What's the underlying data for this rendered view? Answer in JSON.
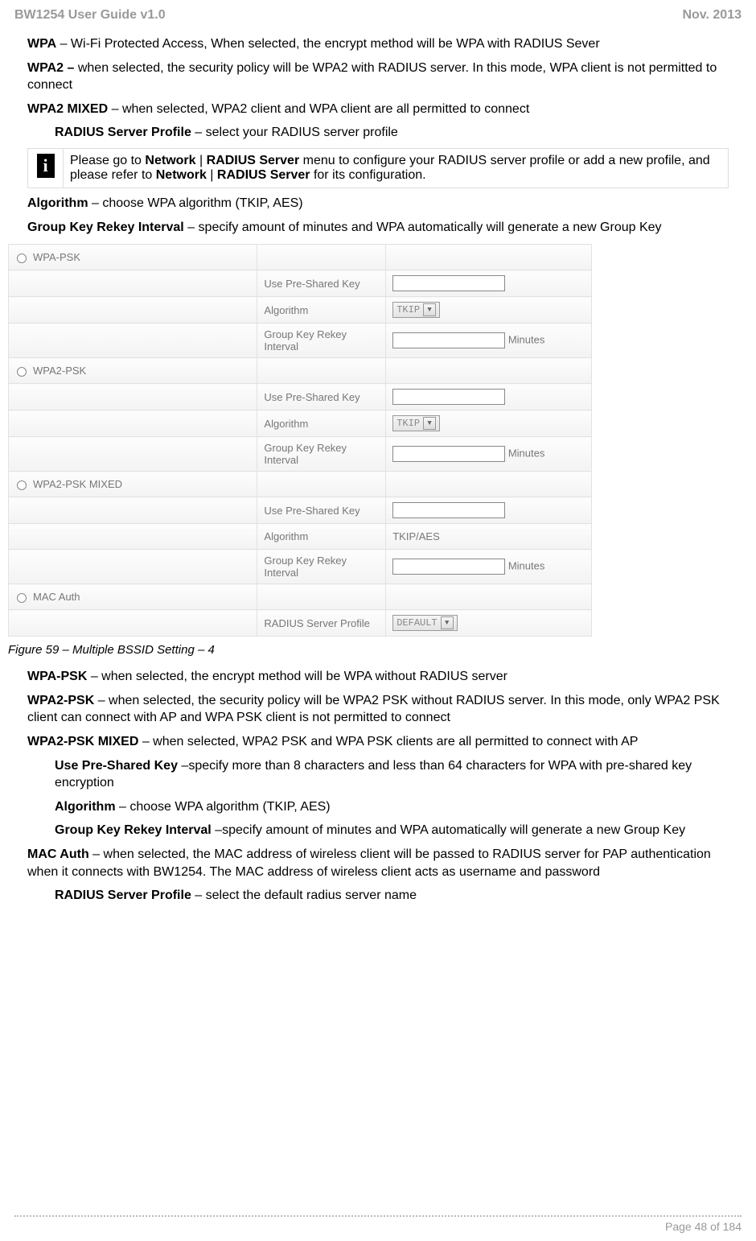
{
  "header": {
    "left": "BW1254 User Guide v1.0",
    "right": "Nov.  2013"
  },
  "p1": {
    "b": "WPA",
    "t": " – Wi-Fi Protected Access, When selected, the encrypt method will be WPA with RADIUS Sever"
  },
  "p2": {
    "b": "WPA2 –",
    "t": " when selected, the security policy will be WPA2 with RADIUS server. In this mode, WPA client is not permitted to connect"
  },
  "p3": {
    "b": "WPA2 MIXED",
    "t": " – when selected, WPA2 client and WPA client are all permitted to connect"
  },
  "p4": {
    "b": "RADIUS Server Profile",
    "t": " – select your RADIUS server profile"
  },
  "note": {
    "pre": "Please go to ",
    "b1": "Network",
    "sep1": " | ",
    "b2": "RADIUS Server",
    "mid": " menu to configure your RADIUS server profile or add a new profile, and please refer to ",
    "b3": "Network",
    "sep2": " | ",
    "b4": "RADIUS Server",
    "post": " for its configuration."
  },
  "p5": {
    "b": "Algorithm",
    "t": " – choose WPA algorithm (TKIP, AES)"
  },
  "p6": {
    "b": "Group Key Rekey Interval",
    "t": " – specify amount of minutes and WPA automatically will generate a new Group Key"
  },
  "cfg": {
    "r1": "WPA-PSK",
    "r2": "WPA2-PSK",
    "r3": "WPA2-PSK MIXED",
    "r4": "MAC Auth",
    "lbl_psk": "Use Pre-Shared Key",
    "lbl_alg": "Algorithm",
    "lbl_grk": "Group Key Rekey Interval",
    "lbl_rad": "RADIUS Server Profile",
    "tkip": "TKIP",
    "tkip_aes": "TKIP/AES",
    "default": "DEFAULT",
    "minutes": "Minutes"
  },
  "caption": "Figure 59 – Multiple BSSID Setting – 4",
  "p7": {
    "b": "WPA-PSK",
    "t": " – when selected, the encrypt method will be WPA without RADIUS server"
  },
  "p8": {
    "b": "WPA2-PSK",
    "t": " – when selected, the security policy will be WPA2 PSK without RADIUS server. In this mode, only WPA2 PSK client can connect with AP and WPA PSK client is not permitted to connect"
  },
  "p9": {
    "b": "WPA2-PSK MIXED",
    "t": " – when selected, WPA2 PSK and WPA PSK clients are all permitted to connect with AP"
  },
  "p10": {
    "b": "Use Pre-Shared Key",
    "t": " –specify more than 8 characters and less than 64 characters for WPA with pre-shared key encryption"
  },
  "p11": {
    "b": "Algorithm",
    "t": " – choose WPA algorithm (TKIP, AES)"
  },
  "p12": {
    "b": "Group Key Rekey Interval",
    "t": " –specify amount of minutes and WPA automatically will generate a new Group Key"
  },
  "p13": {
    "b": "MAC Auth",
    "t": " – when selected, the MAC address of wireless client will be passed to RADIUS server for PAP authentication when it connects with BW1254. The MAC address of wireless client acts as username and password"
  },
  "p14": {
    "b": "RADIUS Server Profile",
    "t": " – select the default radius server name"
  },
  "footer": {
    "page": "Page 48 of 184"
  }
}
